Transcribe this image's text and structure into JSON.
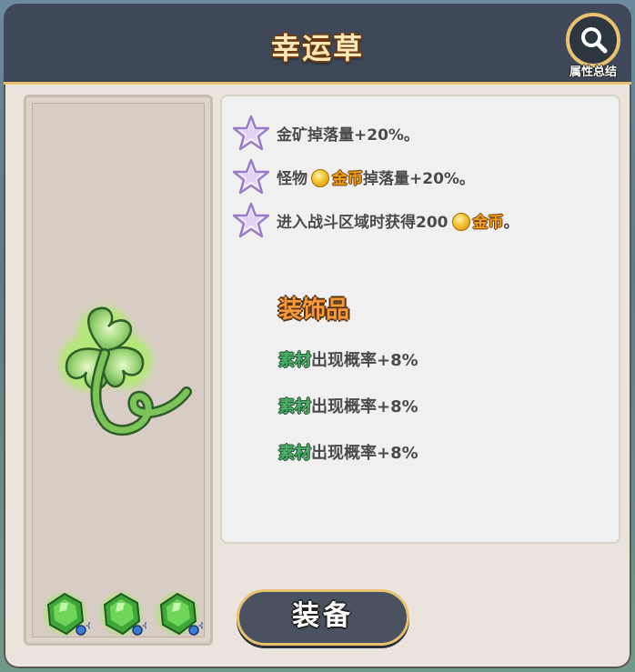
{
  "header": {
    "title": "幸运草",
    "summary_label": "属性总结",
    "summary_icon": "search-icon"
  },
  "item": {
    "icon": "four-leaf-clover-icon",
    "slots": [
      {
        "icon": "green-gem-icon"
      },
      {
        "icon": "green-gem-icon"
      },
      {
        "icon": "green-gem-icon"
      }
    ]
  },
  "effects": [
    {
      "icon": "star-icon",
      "text": "金矿掉落量+20%。"
    },
    {
      "icon": "star-icon",
      "prefix": "怪物",
      "coin_icon": "gold-coin-icon",
      "currency": "金币",
      "suffix": "掉落量+20%。"
    },
    {
      "icon": "star-icon",
      "prefix": "进入战斗区域时获得200",
      "coin_icon": "gold-coin-icon",
      "currency": "金币",
      "suffix": "。"
    }
  ],
  "decoration": {
    "title": "装饰品",
    "bonuses": [
      {
        "material": "素材",
        "text": "出现概率+8%"
      },
      {
        "material": "素材",
        "text": "出现概率+8%"
      },
      {
        "material": "素材",
        "text": "出现概率+8%"
      }
    ]
  },
  "actions": {
    "equip_label": "装备"
  },
  "colors": {
    "header_bg": "#3f4858",
    "accent_gold": "#e8c270",
    "currency_orange": "#f0a020",
    "material_green": "#4caf6a",
    "section_orange": "#f49a3c"
  }
}
